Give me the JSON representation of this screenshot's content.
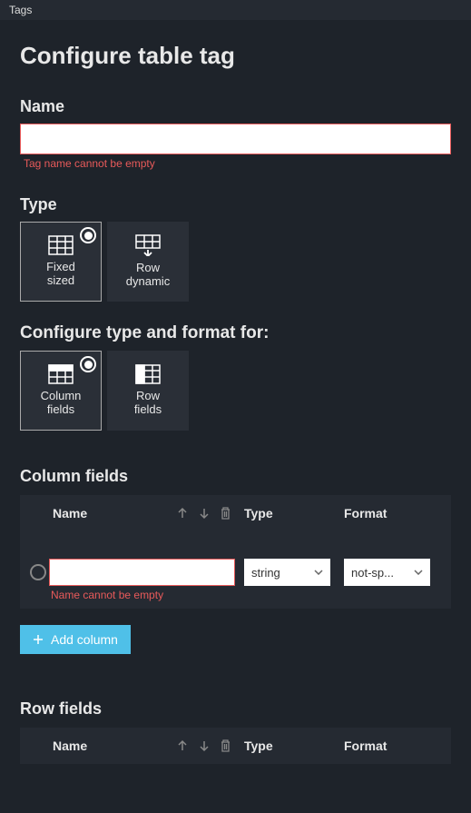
{
  "panel": {
    "header": "Tags"
  },
  "page": {
    "title": "Configure table tag",
    "nameSection": {
      "label": "Name",
      "value": "",
      "error": "Tag name cannot be empty"
    },
    "typeSection": {
      "label": "Type",
      "options": {
        "fixed": {
          "line1": "Fixed",
          "line2": "sized"
        },
        "rowDynamic": {
          "line1": "Row",
          "line2": "dynamic"
        }
      }
    },
    "configureTypeFormat": {
      "label": "Configure type and format for:",
      "options": {
        "columnFields": {
          "line1": "Column",
          "line2": "fields"
        },
        "rowFields": {
          "line1": "Row",
          "line2": "fields"
        }
      }
    },
    "columnFields": {
      "heading": "Column fields",
      "headers": {
        "name": "Name",
        "type": "Type",
        "format": "Format"
      },
      "row": {
        "nameValue": "",
        "nameError": "Name cannot be empty",
        "typeValue": "string",
        "formatValue": "not-sp..."
      },
      "addButton": "Add column"
    },
    "rowFields": {
      "heading": "Row fields",
      "headers": {
        "name": "Name",
        "type": "Type",
        "format": "Format"
      }
    }
  }
}
